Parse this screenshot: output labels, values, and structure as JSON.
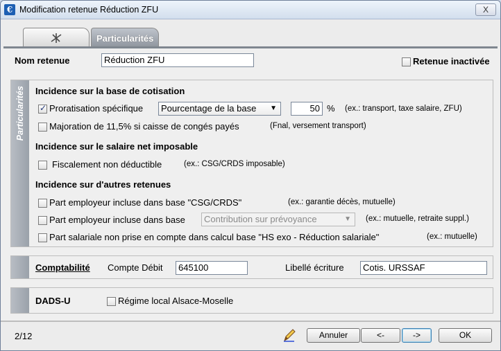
{
  "window": {
    "title": "Modification retenue Réduction ZFU",
    "close_label": "X"
  },
  "tabs": [
    {
      "label": ""
    },
    {
      "label": "Particularités"
    }
  ],
  "header": {
    "nom_label": "Nom retenue",
    "nom_value": "Réduction ZFU",
    "inactive_label": "Retenue inactivée",
    "inactive_checked": false
  },
  "particularites": {
    "side_label": "Particularités",
    "base": {
      "heading": "Incidence sur la base de cotisation",
      "proratisation_label": "Proratisation spécifique",
      "proratisation_checked": true,
      "proratisation_select": "Pourcentage de la base",
      "percent_value": "50",
      "percent_unit": "%",
      "proratisation_note": "(ex.: transport, taxe salaire, ZFU)",
      "majoration_label": "Majoration de 11,5% si caisse de congés payés",
      "majoration_checked": false,
      "majoration_note": "(Fnal, versement transport)"
    },
    "net": {
      "heading": "Incidence sur le salaire net imposable",
      "fiscal_label": "Fiscalement non déductible",
      "fiscal_checked": false,
      "fiscal_note": "(ex.: CSG/CRDS imposable)"
    },
    "autres": {
      "heading": "Incidence sur d'autres retenues",
      "row1_label": "Part employeur incluse dans base \"CSG/CRDS\"",
      "row1_note": "(ex.: garantie décès, mutuelle)",
      "row2_label": "Part employeur incluse dans base",
      "row2_select": "Contribution sur prévoyance",
      "row2_note": "(ex.: mutuelle, retraite suppl.)",
      "row3_label": "Part salariale non prise en compte dans calcul base \"HS exo - Réduction salariale\"",
      "row3_note": "(ex.: mutuelle)"
    }
  },
  "comptabilite": {
    "title": "Comptabilité",
    "debit_label": "Compte Débit",
    "debit_value": "645100",
    "libelle_label": "Libellé écriture",
    "libelle_value": "Cotis. URSSAF"
  },
  "dadsu": {
    "title": "DADS-U",
    "regime_label": "Régime local Alsace-Moselle",
    "regime_checked": false
  },
  "footer": {
    "page": "2/12",
    "annuler": "Annuler",
    "prev": "<-",
    "next": "->",
    "ok": "OK"
  },
  "icons": [
    "app-icon",
    "tab-icon",
    "pencil-icon"
  ],
  "colors": {
    "accent": "#1d5fb3",
    "tab_active": "#8f959e"
  }
}
